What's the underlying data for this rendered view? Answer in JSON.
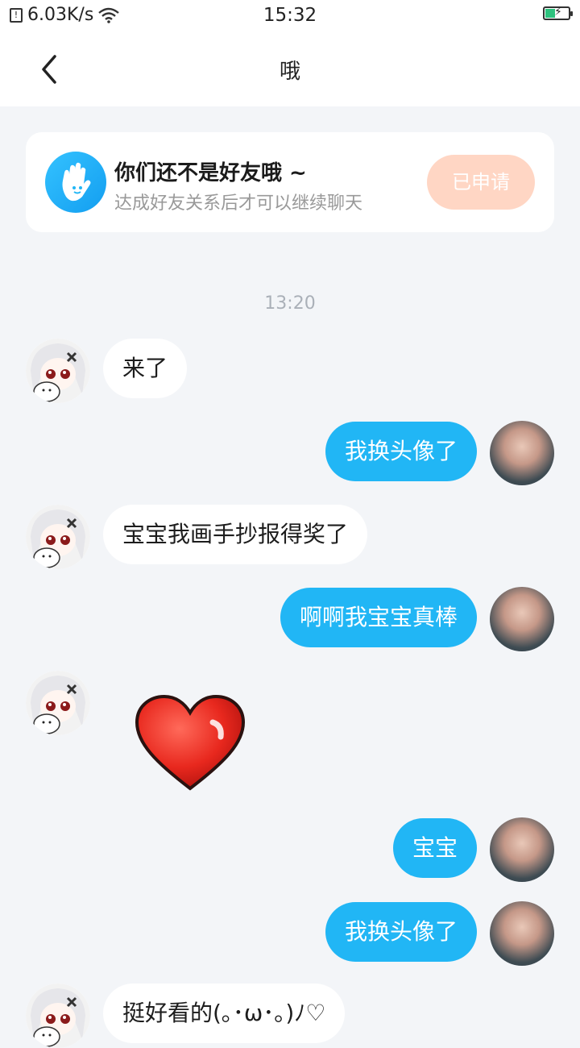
{
  "status": {
    "net_speed": "6.03K/s",
    "time": "15:32"
  },
  "nav": {
    "title": "哦"
  },
  "friend_notice": {
    "title": "你们还不是好友哦 ~",
    "subtitle": "达成好友关系后才可以继续聊天",
    "button": "已申请"
  },
  "chat": {
    "timestamp": "13:20",
    "messages": [
      {
        "side": "in",
        "text": "来了"
      },
      {
        "side": "out",
        "text": "我换头像了"
      },
      {
        "side": "in",
        "text": "宝宝我画手抄报得奖了"
      },
      {
        "side": "out",
        "text": "啊啊我宝宝真棒"
      },
      {
        "side": "in",
        "text": "",
        "sticker": "heart-sticker"
      },
      {
        "side": "out",
        "text": "宝宝"
      },
      {
        "side": "out",
        "text": "我换头像了"
      },
      {
        "side": "in",
        "text": "挺好看的(｡･ω･｡)ﾉ♡"
      }
    ]
  },
  "colors": {
    "accent": "#21b6f5",
    "applied_button": "#ffd6c4",
    "background": "#f3f5f8"
  }
}
